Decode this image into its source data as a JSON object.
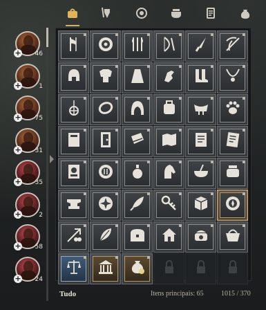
{
  "tabs": [
    {
      "icon": "bag-icon",
      "active": true
    },
    {
      "icon": "weapon-armor-icon",
      "active": false
    },
    {
      "icon": "shield-icon",
      "active": false
    },
    {
      "icon": "cauldron-icon",
      "active": false
    },
    {
      "icon": "scroll-icon",
      "active": false
    },
    {
      "icon": "sack-icon",
      "active": false
    }
  ],
  "characters": [
    {
      "count": "46",
      "variant": false
    },
    {
      "count": "1",
      "variant": false
    },
    {
      "count": "75",
      "variant": false
    },
    {
      "count": "31",
      "variant": false
    },
    {
      "count": "35",
      "variant": true
    },
    {
      "count": "2",
      "variant": true
    },
    {
      "count": "58",
      "variant": true
    },
    {
      "count": "24",
      "variant": true
    }
  ],
  "grid": [
    "axe-icon",
    "round-shield-icon",
    "dual-weapons-icon",
    "bow-icon",
    "knife-icon",
    "crossbow-icon",
    "helmet-icon",
    "chest-armor-icon",
    "cloak-icon",
    "gloves-icon",
    "boots-icon",
    "necklace-icon",
    "amulet-icon",
    "ring-icon",
    "hood-icon",
    "backpack-icon",
    "saddle-icon",
    "paw-icon",
    "book-icon",
    "door-icon",
    "map-scroll-icon",
    "map-icon",
    "note-icon",
    "letter-icon",
    "wanted-poster-icon",
    "plate-icon",
    "potion-icon",
    "horse-icon",
    "bowl-icon",
    "pot-icon",
    "anvil-icon",
    "medallion-icon",
    "quill-icon",
    "key-icon",
    "crate-icon",
    "compass-icon",
    "arrows-icon",
    "feather-icon",
    "chest-icon",
    "house-icon",
    "cooking-pot-icon",
    "basket-icon",
    "scales-icon",
    "bank-icon",
    "money-bag-icon",
    "lock-icon",
    "lock-icon",
    "lock-icon"
  ],
  "footer": {
    "category": "Tudo",
    "main_items": "Itens principais: 65",
    "capacity": "1015 / 370"
  }
}
